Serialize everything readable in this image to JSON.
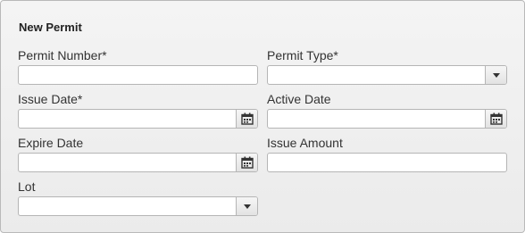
{
  "form": {
    "title": "New Permit",
    "fields": {
      "permit_number": {
        "label": "Permit Number*",
        "value": ""
      },
      "permit_type": {
        "label": "Permit Type*",
        "value": "",
        "icon": "chevron-down-icon"
      },
      "issue_date": {
        "label": "Issue Date*",
        "value": "",
        "icon": "calendar-icon"
      },
      "active_date": {
        "label": "Active Date",
        "value": "",
        "icon": "calendar-icon"
      },
      "expire_date": {
        "label": "Expire Date",
        "value": "",
        "icon": "calendar-icon"
      },
      "issue_amount": {
        "label": "Issue Amount",
        "value": ""
      },
      "lot": {
        "label": "Lot",
        "value": "",
        "icon": "chevron-down-icon"
      }
    }
  },
  "colors": {
    "panel_border": "#b9b9b9",
    "panel_background": "#efefef",
    "input_border": "#b5b5b5",
    "text": "#333333"
  }
}
